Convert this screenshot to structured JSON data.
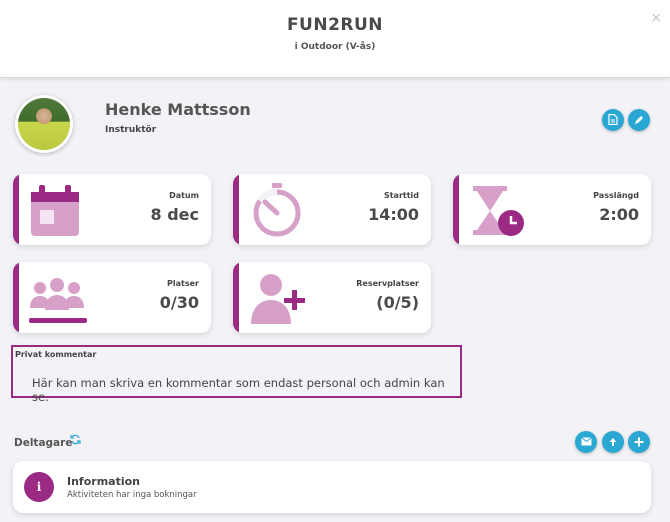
{
  "header": {
    "title": "FUN2RUN",
    "subtitle": "i Outdoor (V-ås)",
    "close_label": "×"
  },
  "instructor": {
    "name": "Henke Mattsson",
    "role": "Instruktör"
  },
  "actions": {
    "document_icon": "document-icon",
    "edit_icon": "pencil-icon"
  },
  "stats": [
    {
      "label": "Datum",
      "value": "8 dec",
      "icon": "calendar-icon"
    },
    {
      "label": "Starttid",
      "value": "14:00",
      "icon": "timer-icon"
    },
    {
      "label": "Passlängd",
      "value": "2:00",
      "icon": "hourglass-icon"
    },
    {
      "label": "Platser",
      "value": "0/30",
      "icon": "group-icon"
    },
    {
      "label": "Reservplatser",
      "value": "(0/5)",
      "icon": "add-user-icon"
    }
  ],
  "comment": {
    "label": "Privat kommentar",
    "text": "Här kan man skriva en kommentar som endast personal och admin kan se."
  },
  "participants": {
    "title": "Deltagare",
    "buttons": [
      "mail-icon",
      "upload-icon",
      "plus-icon"
    ]
  },
  "info": {
    "icon_letter": "i",
    "title": "Information",
    "message": "Aktiviteten har inga bokningar"
  },
  "colors": {
    "accent": "#9b2a84",
    "accent_light": "#d7a0c9",
    "button_blue": "#2aa8d3"
  }
}
